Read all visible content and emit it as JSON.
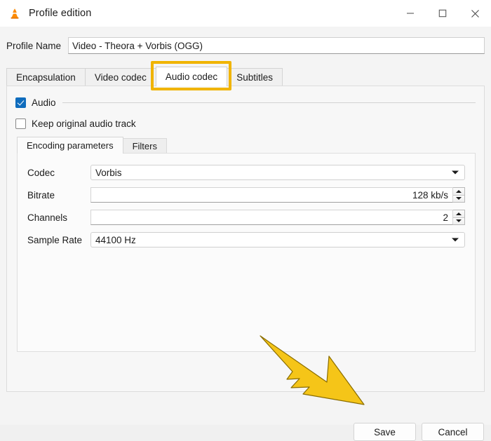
{
  "window": {
    "title": "Profile edition",
    "app_icon": "vlc-cone-icon",
    "controls": {
      "minimize": "minimize-icon",
      "maximize": "maximize-icon",
      "close": "close-icon"
    }
  },
  "profile": {
    "label": "Profile Name",
    "value": "Video - Theora + Vorbis (OGG)",
    "placeholder": "Profile Name"
  },
  "tabs": [
    {
      "label": "Encapsulation",
      "active": false
    },
    {
      "label": "Video codec",
      "active": false
    },
    {
      "label": "Audio codec",
      "active": true
    },
    {
      "label": "Subtitles",
      "active": false
    }
  ],
  "highlight": {
    "target_tab": "Audio codec",
    "color": "#f0b400"
  },
  "audio_panel": {
    "audio_checkbox": {
      "label": "Audio",
      "checked": true
    },
    "keep_original": {
      "label": "Keep original audio track",
      "checked": false
    },
    "inner_tabs": [
      {
        "label": "Encoding parameters",
        "active": true
      },
      {
        "label": "Filters",
        "active": false
      }
    ],
    "fields": [
      {
        "label": "Codec",
        "type": "combo",
        "value": "Vorbis"
      },
      {
        "label": "Bitrate",
        "type": "spin",
        "value": "128 kb/s"
      },
      {
        "label": "Channels",
        "type": "spin",
        "value": "2"
      },
      {
        "label": "Sample Rate",
        "type": "combo",
        "value": "44100 Hz"
      }
    ]
  },
  "footer": {
    "save_label": "Save",
    "cancel_label": "Cancel"
  },
  "annotation": {
    "type": "arrow",
    "points_to": "Save",
    "color": "#f5c518",
    "stroke": "#8a6d00"
  }
}
